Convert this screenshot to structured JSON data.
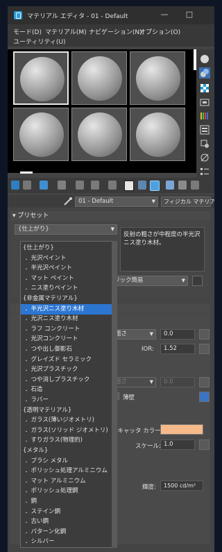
{
  "window": {
    "title": "マテリアル エディタ - 01 - Default",
    "minimize": "—",
    "maximize": "□"
  },
  "menu": {
    "items": [
      "モード(D)",
      "マテリアル(M)",
      "ナビゲーション(N)",
      "オプション(O)",
      "ユーティリティ(U)"
    ]
  },
  "material": {
    "name": "01 - Default",
    "type_button": "フィジカル マテリアル"
  },
  "preset": {
    "header": "プリセット",
    "selected": "{仕上がり}",
    "description": "反射の粗さが中程度の半光沢ニス塗り木材。"
  },
  "mode": {
    "value": "ジック簡易"
  },
  "params": {
    "roughness_label": "粗さ",
    "roughness_value": "0.0",
    "ior_label": "IOR:",
    "ior_value": "1.52",
    "roughness2_label": "粗さ",
    "roughness2_value": "0.0",
    "anisotropy_label": "薄壁",
    "scatter_label": "スキャッタ カラー:",
    "scatter_color": "#f6b98a",
    "scale_label": "スケール:",
    "scale_value": "1.0",
    "luminance_label": "輝度:",
    "luminance_value": "1500 cd/m²"
  },
  "preset_list": {
    "items": [
      {
        "text": "{仕上がり}",
        "highlight": false
      },
      {
        "text": "．光沢ペイント",
        "highlight": false
      },
      {
        "text": "．半光沢ペイント",
        "highlight": false
      },
      {
        "text": "．マット ペイント",
        "highlight": false
      },
      {
        "text": "．ニス塗りペイント",
        "highlight": false
      },
      {
        "text": "{非金属マテリアル}",
        "highlight": false
      },
      {
        "text": "．半光沢ニス塗り木材",
        "highlight": true
      },
      {
        "text": "．光沢ニス塗り木材",
        "highlight": false
      },
      {
        "text": "．ラフ コンクリート",
        "highlight": false
      },
      {
        "text": "．光沢コンクリート",
        "highlight": false
      },
      {
        "text": "．つや出し御影石",
        "highlight": false
      },
      {
        "text": "．グレイズド セラミック",
        "highlight": false
      },
      {
        "text": "．光沢プラスチック",
        "highlight": false
      },
      {
        "text": "．つや消しプラスチック",
        "highlight": false
      },
      {
        "text": "．石造",
        "highlight": false
      },
      {
        "text": "．ラバー",
        "highlight": false
      },
      {
        "text": "{透明マテリアル}",
        "highlight": false
      },
      {
        "text": "．ガラス(薄いジオメトリ)",
        "highlight": false
      },
      {
        "text": "．ガラス(ソリッド ジオメトリ)",
        "highlight": false
      },
      {
        "text": "．すりガラス(物理的)",
        "highlight": false
      },
      {
        "text": "{メタル}",
        "highlight": false
      },
      {
        "text": "．ブラシ メタル",
        "highlight": false
      },
      {
        "text": "．ポリッシュ処理アルミニウム",
        "highlight": false
      },
      {
        "text": "．マット アルミニウム",
        "highlight": false
      },
      {
        "text": "．ポリッシュ処理鋼",
        "highlight": false
      },
      {
        "text": "．鋼",
        "highlight": false
      },
      {
        "text": "．ステイン鋼",
        "highlight": false
      },
      {
        "text": "．古い鋼",
        "highlight": false
      },
      {
        "text": "．パターン化鋼",
        "highlight": false
      },
      {
        "text": "．シルバー",
        "highlight": false
      }
    ]
  },
  "icons": {
    "sidebar": [
      "sphere-icon",
      "backlight-icon",
      "checker-icon",
      "video-icon",
      "color-bars-icon",
      "options-icon",
      "select-by-material-icon",
      "navigator-icon"
    ],
    "toolbar": [
      "get-material-icon",
      "put-material-icon",
      "assign-material-icon",
      "reset-icon",
      "copy-icon",
      "unique-icon",
      "put-library-icon",
      "material-id-icon",
      "show-map-icon",
      "show-end-result-icon",
      "go-parent-icon",
      "go-sibling-icon"
    ]
  }
}
